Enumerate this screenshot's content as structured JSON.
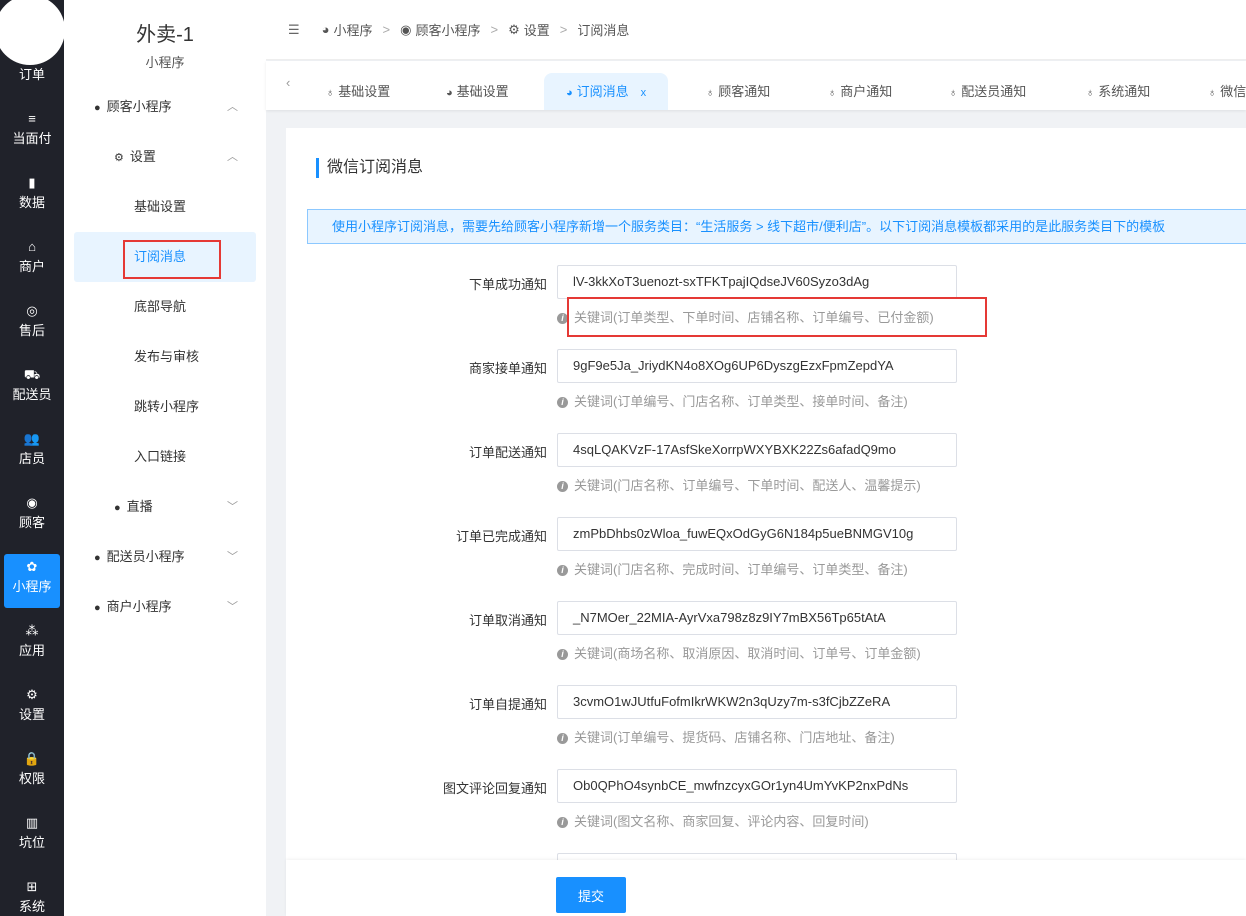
{
  "nav": {
    "items": [
      "订单",
      "当面付",
      "数据",
      "商户",
      "售后",
      "配送员",
      "店员",
      "顾客",
      "小程序",
      "应用",
      "设置",
      "权限",
      "坑位",
      "系统"
    ],
    "icons": [
      "≡",
      "▮",
      "⌂",
      "◎",
      "⛟",
      "👥",
      "◉",
      "✿",
      "⁂",
      "⚙",
      "🔒",
      "▥",
      "⊞"
    ],
    "active": "小程序"
  },
  "side": {
    "app_title": "外卖-1",
    "app_sub": "小程序",
    "items": [
      {
        "label": "顾客小程序",
        "icon": "user-circle-icon",
        "chev": "︿"
      },
      {
        "label": "设置",
        "icon": "gear-icon",
        "chev": "︿"
      },
      {
        "label": "基础设置"
      },
      {
        "label": "订阅消息"
      },
      {
        "label": "底部导航"
      },
      {
        "label": "发布与审核"
      },
      {
        "label": "跳转小程序"
      },
      {
        "label": "入口链接"
      },
      {
        "label": "直播",
        "icon": "video-icon",
        "chev": "﹀"
      },
      {
        "label": "配送员小程序",
        "icon": "delivery-icon",
        "chev": "﹀"
      },
      {
        "label": "商户小程序",
        "icon": "shop-icon",
        "chev": "﹀"
      }
    ]
  },
  "breadcrumb": [
    "小程序",
    "顾客小程序",
    "设置",
    "订阅消息"
  ],
  "tabs": [
    "基础设置",
    "基础设置",
    "订阅消息",
    "顾客通知",
    "商户通知",
    "配送员通知",
    "系统通知",
    "微信"
  ],
  "tab_close": "x",
  "page": {
    "title": "微信订阅消息",
    "notice": "使用小程序订阅消息，需要先给顾客小程序新增一个服务类目：“生活服务 > 线下超市/便利店”。以下订阅消息模板都采用的是此服务类目下的模板"
  },
  "rows": [
    {
      "label": "下单成功通知",
      "value": "lV-3kkXoT3uenozt-sxTFKTpajIQdseJV60Syzo3dAg",
      "hint": "关键词(订单类型、下单时间、店铺名称、订单编号、已付金额)"
    },
    {
      "label": "商家接单通知",
      "value": "9gF9e5Ja_JriydKN4o8XOg6UP6DyszgEzxFpmZepdYA",
      "hint": "关键词(订单编号、门店名称、订单类型、接单时间、备注)"
    },
    {
      "label": "订单配送通知",
      "value": "4sqLQAKVzF-17AsfSkeXorrpWXYBXK22Zs6afadQ9mo",
      "hint": "关键词(门店名称、订单编号、下单时间、配送人、温馨提示)"
    },
    {
      "label": "订单已完成通知",
      "value": "zmPbDhbs0zWloa_fuwEQxOdGyG6N184p5ueBNMGV10g",
      "hint": "关键词(门店名称、完成时间、订单编号、订单类型、备注)"
    },
    {
      "label": "订单取消通知",
      "value": "_N7MOer_22MIA-AyrVxa798z8z9IY7mBX56Tp65tAtA",
      "hint": "关键词(商场名称、取消原因、取消时间、订单号、订单金额)"
    },
    {
      "label": "订单自提通知",
      "value": "3cvmO1wJUtfuFofmIkrWKW2n3qUzy7m-s3fCjbZZeRA",
      "hint": "关键词(订单编号、提货码、店铺名称、门店地址、备注)"
    },
    {
      "label": "图文评论回复通知",
      "value": "Ob0QPhO4synbCE_mwfnzcyxGOr1yn4UmYvKP2nxPdNs",
      "hint": "关键词(图文名称、商家回复、评论内容、回复时间)"
    }
  ],
  "submit": "提交"
}
